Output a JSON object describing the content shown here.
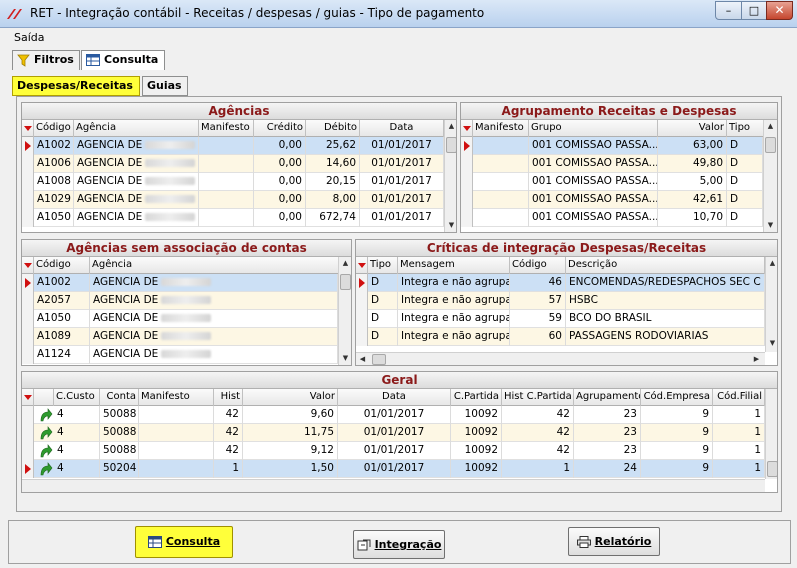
{
  "window": {
    "title": "RET - Integração contábil - Receitas / despesas / guias - Tipo de pagamento",
    "min": "–",
    "max": "□",
    "close": "✕"
  },
  "menu": {
    "saida": "Saída"
  },
  "tabs": {
    "filtros": "Filtros",
    "consulta": "Consulta"
  },
  "subtabs": {
    "despesas": "Despesas/Receitas",
    "guias": "Guias"
  },
  "agencias": {
    "title": "Agências",
    "columns": [
      "Código",
      "Agência",
      "Manifesto",
      "Crédito",
      "Débito",
      "Data"
    ],
    "rows": [
      {
        "codigo": "A1002",
        "agencia": "AGENCIA DE",
        "manifesto": "",
        "credito": "0,00",
        "debito": "25,62",
        "data": "01/01/2017"
      },
      {
        "codigo": "A1006",
        "agencia": "AGENCIA DE",
        "manifesto": "",
        "credito": "0,00",
        "debito": "14,60",
        "data": "01/01/2017"
      },
      {
        "codigo": "A1008",
        "agencia": "AGENCIA DE",
        "manifesto": "",
        "credito": "0,00",
        "debito": "20,15",
        "data": "01/01/2017"
      },
      {
        "codigo": "A1029",
        "agencia": "AGENCIA  DE",
        "manifesto": "",
        "credito": "0,00",
        "debito": "8,00",
        "data": "01/01/2017"
      },
      {
        "codigo": "A1050",
        "agencia": "AGENCIA DE",
        "manifesto": "",
        "credito": "0,00",
        "debito": "672,74",
        "data": "01/01/2017"
      }
    ]
  },
  "agrupamento": {
    "title": "Agrupamento Receitas e Despesas",
    "columns": [
      "Manifesto",
      "Grupo",
      "Valor",
      "Tipo"
    ],
    "rows": [
      {
        "manifesto": "",
        "grupo": "001 COMISSAO PASSA...",
        "valor": "63,00",
        "tipo": "D"
      },
      {
        "manifesto": "",
        "grupo": "001 COMISSAO PASSA...",
        "valor": "49,80",
        "tipo": "D"
      },
      {
        "manifesto": "",
        "grupo": "001 COMISSAO PASSA...",
        "valor": "5,00",
        "tipo": "D"
      },
      {
        "manifesto": "",
        "grupo": "001 COMISSAO PASSA...",
        "valor": "42,61",
        "tipo": "D"
      },
      {
        "manifesto": "",
        "grupo": "001 COMISSAO PASSA...",
        "valor": "10,70",
        "tipo": "D"
      }
    ]
  },
  "semassoc": {
    "title": "Agências sem associação de contas",
    "columns": [
      "Código",
      "Agência"
    ],
    "rows": [
      {
        "codigo": "A1002",
        "agencia": "AGENCIA DE"
      },
      {
        "codigo": "A2057",
        "agencia": "AGENCIA DE"
      },
      {
        "codigo": "A1050",
        "agencia": "AGENCIA DE"
      },
      {
        "codigo": "A1089",
        "agencia": "AGENCIA DE"
      },
      {
        "codigo": "A1124",
        "agencia": "AGENCIA DE"
      }
    ]
  },
  "criticas": {
    "title": "Críticas de integração Despesas/Receitas",
    "columns": [
      "Tipo",
      "Mensagem",
      "Código",
      "Descrição"
    ],
    "rows": [
      {
        "tipo": "D",
        "mensagem": "Integra e não agrupa...",
        "codigo": "46",
        "descricao": "ENCOMENDAS/REDESPACHOS SEC C"
      },
      {
        "tipo": "D",
        "mensagem": "Integra e não agrupa...",
        "codigo": "57",
        "descricao": "HSBC"
      },
      {
        "tipo": "D",
        "mensagem": "Integra e não agrupa...",
        "codigo": "59",
        "descricao": "BCO DO BRASIL"
      },
      {
        "tipo": "D",
        "mensagem": "Integra e não agrupa...",
        "codigo": "60",
        "descricao": "PASSAGENS RODOVIARIAS"
      }
    ]
  },
  "geral": {
    "title": "Geral",
    "columns": [
      "C.Custo",
      "Conta",
      "Manifesto",
      "Hist",
      "Valor",
      "Data",
      "C.Partida",
      "Hist C.Partida",
      "Agrupamento",
      "Cód.Empresa",
      "Cód.Filial"
    ],
    "rows": [
      {
        "ccusto": "4",
        "conta": "50088",
        "manifesto": "",
        "hist": "42",
        "valor": "9,60",
        "data": "01/01/2017",
        "cpartida": "10092",
        "histcp": "42",
        "agrup": "23",
        "empresa": "9",
        "filial": "1"
      },
      {
        "ccusto": "4",
        "conta": "50088",
        "manifesto": "",
        "hist": "42",
        "valor": "11,75",
        "data": "01/01/2017",
        "cpartida": "10092",
        "histcp": "42",
        "agrup": "23",
        "empresa": "9",
        "filial": "1"
      },
      {
        "ccusto": "4",
        "conta": "50088",
        "manifesto": "",
        "hist": "42",
        "valor": "9,12",
        "data": "01/01/2017",
        "cpartida": "10092",
        "histcp": "42",
        "agrup": "23",
        "empresa": "9",
        "filial": "1"
      },
      {
        "ccusto": "4",
        "conta": "50204",
        "manifesto": "",
        "hist": "1",
        "valor": "1,50",
        "data": "01/01/2017",
        "cpartida": "10092",
        "histcp": "1",
        "agrup": "24",
        "empresa": "9",
        "filial": "1"
      }
    ]
  },
  "buttons": {
    "consulta": "Consulta",
    "integracao": "Integração",
    "relatorio": "Relatório"
  },
  "colors": {
    "accent_yellow": "#ffff3a",
    "title_red": "#8b1a1a",
    "selected_row": "#cce0f5"
  }
}
